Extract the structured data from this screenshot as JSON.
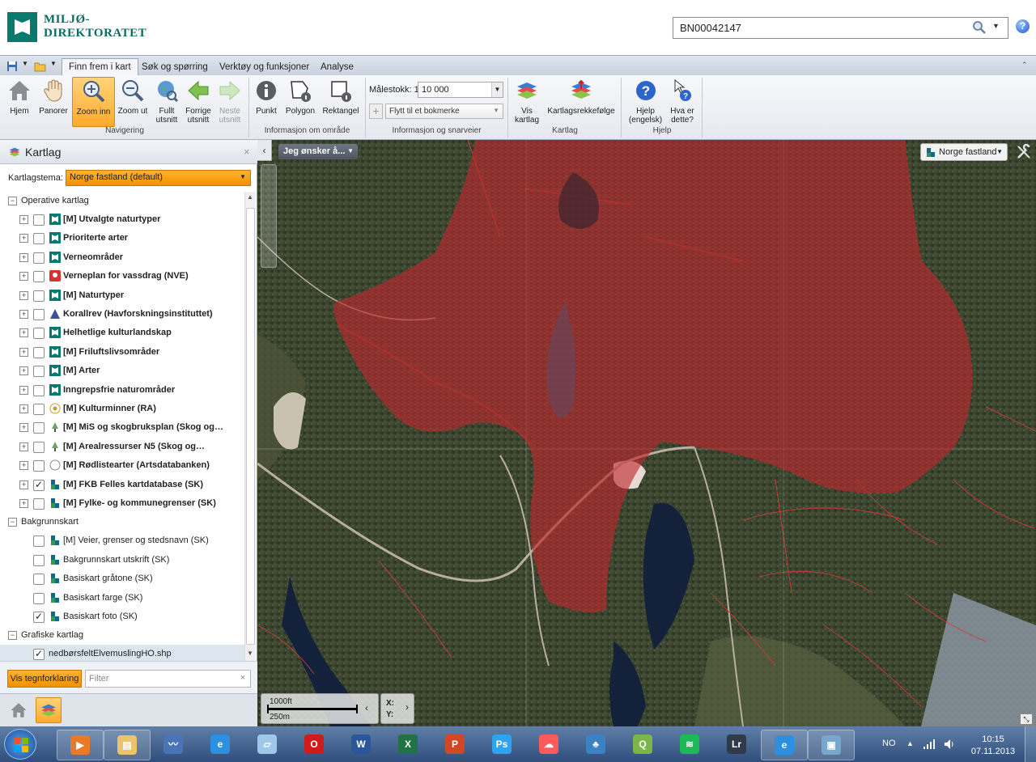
{
  "header": {
    "logo_line1": "MILJØ-",
    "logo_line2": "DIREKTORATET",
    "search_value": "BN00042147",
    "help_icon_label": "?"
  },
  "ribbon": {
    "tabs": [
      "Finn frem i kart",
      "Søk og spørring",
      "Verktøy og funksjoner",
      "Analyse"
    ],
    "active_tab": "Finn frem i kart",
    "navigering": {
      "buttons": [
        {
          "label": "Hjem",
          "icon": "home-icon"
        },
        {
          "label": "Panorer",
          "icon": "hand-icon"
        },
        {
          "label": "Zoom inn",
          "icon": "zoom-in-icon",
          "selected": true
        },
        {
          "label": "Zoom ut",
          "icon": "zoom-out-icon"
        },
        {
          "label": "Fullt utsnitt",
          "icon": "globe-icon"
        },
        {
          "label": "Forrige utsnitt",
          "icon": "arrow-left-icon"
        },
        {
          "label": "Neste utsnitt",
          "icon": "arrow-right-icon",
          "disabled": true
        }
      ],
      "group_label": "Navigering"
    },
    "informasjon": {
      "buttons": [
        {
          "label": "Punkt",
          "icon": "info-icon"
        },
        {
          "label": "Polygon",
          "icon": "polygon-info-icon"
        },
        {
          "label": "Rektangel",
          "icon": "rectangle-info-icon"
        }
      ],
      "group_label": "Informasjon om område"
    },
    "snarveier": {
      "scale_label": "Målestokk: 1:",
      "scale_value": "10 000",
      "bookmark_placeholder": "Flytt til et bokmerke",
      "group_label": "Informasjon og snarveier"
    },
    "kartlag": {
      "buttons": [
        {
          "label": "Vis kartlag",
          "icon": "layers-icon"
        },
        {
          "label": "Kartlagsrekkefølge",
          "icon": "layer-order-icon"
        }
      ],
      "group_label": "Kartlag"
    },
    "hjelp": {
      "buttons": [
        {
          "label": "Hjelp (engelsk)",
          "icon": "help-icon"
        },
        {
          "label": "Hva er dette?",
          "icon": "whats-this-icon"
        }
      ],
      "group_label": "Hjelp"
    }
  },
  "panel": {
    "title": "Kartlag",
    "theme_label": "Kartlagstema:",
    "theme_value": "Norge fastland (default)",
    "sections": [
      {
        "title": "Operative kartlag",
        "items": [
          {
            "label": "[M] Utvalgte naturtyper",
            "checked": false,
            "icon": "md-icon"
          },
          {
            "label": "Prioriterte arter",
            "checked": false,
            "icon": "md-icon"
          },
          {
            "label": "Verneområder",
            "checked": false,
            "icon": "md-icon"
          },
          {
            "label": "Verneplan for vassdrag (NVE)",
            "checked": false,
            "icon": "nve-icon"
          },
          {
            "label": "[M] Naturtyper",
            "checked": false,
            "icon": "md-icon"
          },
          {
            "label": "Korallrev (Havforskningsinstituttet)",
            "checked": false,
            "icon": "imr-icon"
          },
          {
            "label": "Helhetlige kulturlandskap",
            "checked": false,
            "icon": "md-icon"
          },
          {
            "label": "[M] Friluftslivsområder",
            "checked": false,
            "icon": "md-icon"
          },
          {
            "label": "[M] Arter",
            "checked": false,
            "icon": "md-icon"
          },
          {
            "label": "Inngrepsfrie naturområder",
            "checked": false,
            "icon": "md-icon"
          },
          {
            "label": "[M] Kulturminner (RA)",
            "checked": false,
            "icon": "ra-icon"
          },
          {
            "label": "[M] MiS og skogbruksplan (Skog og…",
            "checked": false,
            "icon": "tree-icon"
          },
          {
            "label": "[M] Arealressurser N5 (Skog og…",
            "checked": false,
            "icon": "tree-icon"
          },
          {
            "label": "[M] Rødlistearter (Artsdatabanken)",
            "checked": false,
            "icon": "adb-icon"
          },
          {
            "label": "[M] FKB Felles kartdatabase (SK)",
            "checked": true,
            "icon": "sk-icon"
          },
          {
            "label": "[M] Fylke- og kommunegrenser (SK)",
            "checked": false,
            "icon": "sk-icon"
          }
        ]
      },
      {
        "title": "Bakgrunnskart",
        "items": [
          {
            "label": "[M] Veier, grenser og stedsnavn (SK)",
            "checked": false,
            "icon": "sk-icon"
          },
          {
            "label": "Bakgrunnskart utskrift (SK)",
            "checked": false,
            "icon": "sk-icon"
          },
          {
            "label": "Basiskart gråtone (SK)",
            "checked": false,
            "icon": "sk-icon"
          },
          {
            "label": "Basiskart farge (SK)",
            "checked": false,
            "icon": "sk-icon"
          },
          {
            "label": "Basiskart foto (SK)",
            "checked": true,
            "icon": "sk-icon"
          }
        ]
      },
      {
        "title": "Grafiske kartlag",
        "items": [
          {
            "label": "nedbørsfeltElvemuslingHO.shp",
            "checked": true,
            "icon": ""
          }
        ]
      }
    ],
    "legend_button": "Vis tegnforklaring",
    "filter_placeholder": "Filter"
  },
  "map": {
    "dropdown_label": "Jeg ønsker å...",
    "basemap_label": "Norge fastland",
    "scale_ft": "1000ft",
    "scale_m": "250m",
    "coord_x": "X:",
    "coord_y": "Y:",
    "overlay_color": "#c0282d"
  },
  "taskbar": {
    "language": "NO",
    "time": "10:15",
    "date": "07.11.2013",
    "apps": [
      "media-player-icon",
      "file-explorer-icon",
      "stock-app-icon",
      "ie-icon",
      "notes-icon",
      "opera-icon",
      "word-icon",
      "excel-icon",
      "powerpoint-icon",
      "photoshop-icon",
      "creative-cloud-icon",
      "network-icon",
      "qgis-icon",
      "spotify-icon",
      "lightroom-icon",
      "ie-active-icon",
      "display-icon"
    ]
  }
}
